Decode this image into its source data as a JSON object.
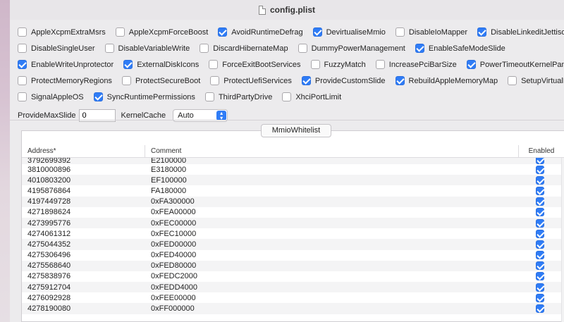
{
  "window": {
    "title": "config.plist"
  },
  "quirks": {
    "rows": [
      [
        {
          "label": "AppleXcpmExtraMsrs",
          "checked": false
        },
        {
          "label": "AppleXcpmForceBoost",
          "checked": false
        },
        {
          "label": "AvoidRuntimeDefrag",
          "checked": true
        },
        {
          "label": "DevirtualiseMmio",
          "checked": true
        },
        {
          "label": "DisableIoMapper",
          "checked": false
        },
        {
          "label": "DisableLinkeditJettison",
          "checked": true
        }
      ],
      [
        {
          "label": "DisableSingleUser",
          "checked": false
        },
        {
          "label": "DisableVariableWrite",
          "checked": false
        },
        {
          "label": "DiscardHibernateMap",
          "checked": false
        },
        {
          "label": "DummyPowerManagement",
          "checked": false
        },
        {
          "label": "EnableSafeModeSlide",
          "checked": true
        }
      ],
      [
        {
          "label": "EnableWriteUnprotector",
          "checked": true
        },
        {
          "label": "ExternalDiskIcons",
          "checked": true
        },
        {
          "label": "ForceExitBootServices",
          "checked": false
        },
        {
          "label": "FuzzyMatch",
          "checked": false
        },
        {
          "label": "IncreasePciBarSize",
          "checked": false
        },
        {
          "label": "PowerTimeoutKernelPanic",
          "checked": true
        }
      ],
      [
        {
          "label": "ProtectMemoryRegions",
          "checked": false
        },
        {
          "label": "ProtectSecureBoot",
          "checked": false
        },
        {
          "label": "ProtectUefiServices",
          "checked": false
        },
        {
          "label": "ProvideCustomSlide",
          "checked": true
        },
        {
          "label": "RebuildAppleMemoryMap",
          "checked": true
        },
        {
          "label": "SetupVirtualMap",
          "checked": false
        }
      ],
      [
        {
          "label": "SignalAppleOS",
          "checked": false
        },
        {
          "label": "SyncRuntimePermissions",
          "checked": true
        },
        {
          "label": "ThirdPartyDrive",
          "checked": false
        },
        {
          "label": "XhciPortLimit",
          "checked": false
        }
      ]
    ],
    "provide_max_slide": {
      "label": "ProvideMaxSlide",
      "value": "0"
    },
    "kernel_cache": {
      "label": "KernelCache",
      "value": "Auto"
    }
  },
  "section_tab": "MmioWhitelist",
  "table": {
    "columns": {
      "address": "Address*",
      "comment": "Comment",
      "enabled": "Enabled"
    },
    "rows": [
      {
        "address": "3792699392",
        "comment": "E2100000",
        "enabled": true
      },
      {
        "address": "3810000896",
        "comment": "E3180000",
        "enabled": true
      },
      {
        "address": "4010803200",
        "comment": "EF100000",
        "enabled": true
      },
      {
        "address": "4195876864",
        "comment": "FA180000",
        "enabled": true
      },
      {
        "address": "4197449728",
        "comment": "0xFA300000",
        "enabled": true
      },
      {
        "address": "4271898624",
        "comment": "0xFEA00000",
        "enabled": true
      },
      {
        "address": "4273995776",
        "comment": "0xFEC00000",
        "enabled": true
      },
      {
        "address": "4274061312",
        "comment": "0xFEC10000",
        "enabled": true
      },
      {
        "address": "4275044352",
        "comment": "0xFED00000",
        "enabled": true
      },
      {
        "address": "4275306496",
        "comment": "0xFED40000",
        "enabled": true
      },
      {
        "address": "4275568640",
        "comment": "0xFED80000",
        "enabled": true
      },
      {
        "address": "4275838976",
        "comment": "0xFEDC2000",
        "enabled": true
      },
      {
        "address": "4275912704",
        "comment": "0xFEDD4000",
        "enabled": true
      },
      {
        "address": "4276092928",
        "comment": "0xFEE00000",
        "enabled": true
      },
      {
        "address": "4278190080",
        "comment": "0xFF000000",
        "enabled": true
      }
    ]
  },
  "colors": {
    "accent": "#2f7cf6",
    "window_bg": "#ecebed"
  }
}
